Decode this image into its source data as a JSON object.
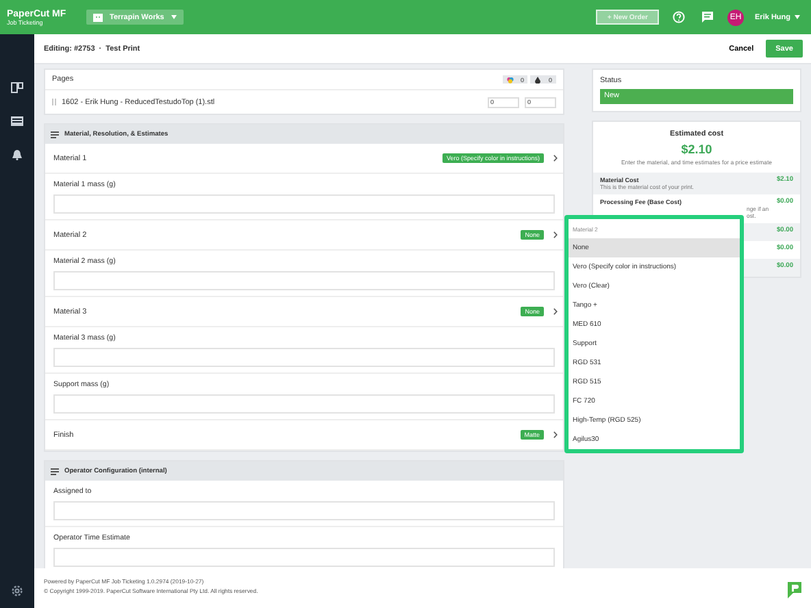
{
  "top_bar": {
    "logo": "PaperCut MF",
    "logo_subtitle": "Job Ticketing",
    "workspace": "Terrapin Works",
    "new_order": {
      "label": "+ New Order",
      "disabled": true
    },
    "user_initials": "EH",
    "user_name": "Erik Hung"
  },
  "header": {
    "title": "Editing: #2753",
    "separator": "·",
    "subtitle": "Test Print",
    "cancel": "Cancel",
    "save": "Save"
  },
  "pages": {
    "label": "Pages",
    "counts": [
      "0",
      "0"
    ],
    "file": "1602 - Erik Hung - ReducedTestudoTop (1).stl",
    "inputs": [
      "0",
      "0"
    ]
  },
  "sections": [
    {
      "title": "Material, Resolution, & Estimates",
      "rows": [
        {
          "kind": "select",
          "label": "Material 1",
          "value": "Vero (Specify color in instructions)"
        },
        {
          "kind": "input",
          "label": "Material 1 mass (g)"
        },
        {
          "kind": "select",
          "label": "Material 2",
          "value": "None"
        },
        {
          "kind": "input",
          "label": "Material 2 mass (g)"
        },
        {
          "kind": "select",
          "label": "Material 3",
          "value": "None"
        },
        {
          "kind": "input",
          "label": "Material 3 mass (g)"
        },
        {
          "kind": "input",
          "label": "Support mass (g)"
        },
        {
          "kind": "select",
          "label": "Finish",
          "value": "Matte"
        }
      ]
    },
    {
      "title": "Operator Configuration (internal)",
      "rows": [
        {
          "kind": "input",
          "label": "Assigned to"
        },
        {
          "kind": "input",
          "label": "Operator Time Estimate"
        }
      ]
    }
  ],
  "status": {
    "label": "Status",
    "value": "New"
  },
  "estimate": {
    "title": "Estimated cost",
    "total": "$2.10",
    "hint": "Enter the material, and time estimates for a price estimate",
    "items": [
      {
        "label": "Material Cost",
        "description": "This is the material cost of your print.",
        "amount": "$2.10"
      },
      {
        "label": "Processing Fee (Base Cost)",
        "description": "nge if an ost.",
        "amount": "$0.00"
      },
      {
        "amount": "$0.00"
      },
      {
        "amount": "$0.00"
      },
      {
        "amount": "$0.00"
      }
    ]
  },
  "dropdown": {
    "header": "Material 2",
    "options": [
      {
        "label": "None",
        "selected": true
      },
      {
        "label": "Vero (Specify color in instructions)",
        "selected": false
      },
      {
        "label": "Vero (Clear)",
        "selected": false
      },
      {
        "label": "Tango +",
        "selected": false
      },
      {
        "label": "MED 610",
        "selected": false
      },
      {
        "label": "Support",
        "selected": false
      },
      {
        "label": "RGD 531",
        "selected": false
      },
      {
        "label": "RGD 515",
        "selected": false
      },
      {
        "label": "FC 720",
        "selected": false
      },
      {
        "label": "High-Temp (RGD 525)",
        "selected": false
      },
      {
        "label": "Agilus30",
        "selected": false
      }
    ]
  },
  "footer": {
    "lines": [
      "Powered by PaperCut MF Job Ticketing 1.0.2974 (2019-10-27)",
      "© Copyright 1999-2019. PaperCut Software International Pty Ltd. All rights reserved."
    ]
  }
}
